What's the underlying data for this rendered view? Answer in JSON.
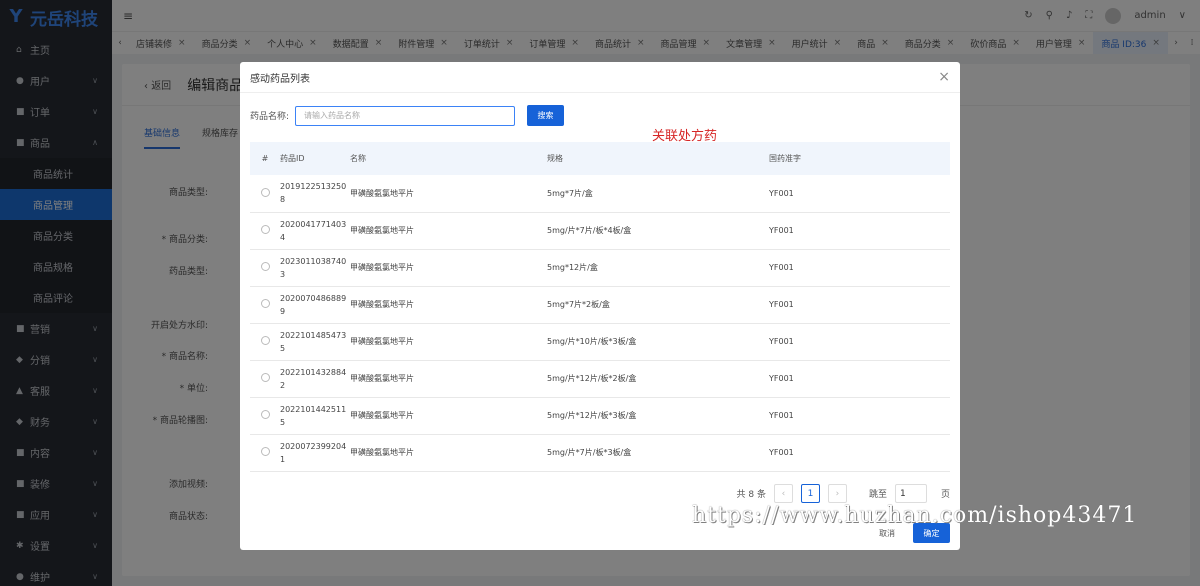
{
  "brand": {
    "name": "元岳科技"
  },
  "sidebar": {
    "items": [
      {
        "label": "主页",
        "icon": "home-icon",
        "glyph": "⌂"
      },
      {
        "label": "用户",
        "icon": "user-icon",
        "glyph": "●",
        "chevron": "∨"
      },
      {
        "label": "订单",
        "icon": "order-icon",
        "glyph": "■",
        "chevron": "∨"
      },
      {
        "label": "商品",
        "icon": "goods-icon",
        "glyph": "■",
        "chevron": "∧"
      }
    ],
    "subitems": [
      {
        "label": "商品统计"
      },
      {
        "label": "商品管理",
        "active": true
      },
      {
        "label": "商品分类"
      },
      {
        "label": "商品规格"
      },
      {
        "label": "商品评论"
      }
    ],
    "items2": [
      {
        "label": "营销",
        "icon": "marketing-icon",
        "glyph": "■",
        "chevron": "∨"
      },
      {
        "label": "分销",
        "icon": "distribution-icon",
        "glyph": "◆",
        "chevron": "∨"
      },
      {
        "label": "客服",
        "icon": "service-icon",
        "glyph": "▲",
        "chevron": "∨"
      },
      {
        "label": "财务",
        "icon": "finance-icon",
        "glyph": "◆",
        "chevron": "∨"
      },
      {
        "label": "内容",
        "icon": "content-icon",
        "glyph": "■",
        "chevron": "∨"
      },
      {
        "label": "装修",
        "icon": "decorate-icon",
        "glyph": "■",
        "chevron": "∨"
      },
      {
        "label": "应用",
        "icon": "apps-icon",
        "glyph": "■",
        "chevron": "∨"
      },
      {
        "label": "设置",
        "icon": "settings-icon",
        "glyph": "✱",
        "chevron": "∨"
      },
      {
        "label": "维护",
        "icon": "maintain-icon",
        "glyph": "●",
        "chevron": "∨"
      }
    ]
  },
  "topbar": {
    "menu_glyph": "≡",
    "user": "admin"
  },
  "tabs": [
    "店铺装修",
    "商品分类",
    "个人中心",
    "数据配置",
    "附件管理",
    "订单统计",
    "订单管理",
    "商品统计",
    "商品管理",
    "文章管理",
    "用户统计",
    "商品",
    "商品分类",
    "砍价商品",
    "用户管理",
    "商品 ID:36"
  ],
  "page": {
    "back": "返回",
    "title": "编辑商品",
    "tab_basic": "基础信息",
    "tab_spec": "规格库存",
    "labels": {
      "type": "商品类型:",
      "category": "* 商品分类:",
      "drug_type": "药品类型:",
      "watermark": "开启处方水印:",
      "name": "* 商品名称:",
      "unit": "* 单位:",
      "images": "* 商品轮播图:",
      "video": "添加视频:",
      "status": "商品状态:"
    }
  },
  "modal": {
    "title": "感动药品列表",
    "search_label": "药品名称:",
    "search_placeholder": "请输入药品名称",
    "search_button": "搜索",
    "annotation": "关联处方药",
    "columns": [
      "#",
      "药品ID",
      "名称",
      "规格",
      "国药准字"
    ],
    "rows": [
      {
        "id": "20191225132508",
        "name": "甲磺酸氨氯地平片",
        "spec": "5mg*7片/盒",
        "code": "YF001"
      },
      {
        "id": "20200417714034",
        "name": "甲磺酸氨氯地平片",
        "spec": "5mg/片*7片/板*4板/盒",
        "code": "YF001"
      },
      {
        "id": "20230110387403",
        "name": "甲磺酸氨氯地平片",
        "spec": "5mg*12片/盒",
        "code": "YF001"
      },
      {
        "id": "20200704868899",
        "name": "甲磺酸氨氯地平片",
        "spec": "5mg*7片*2板/盒",
        "code": "YF001"
      },
      {
        "id": "20221014854735",
        "name": "甲磺酸氨氯地平片",
        "spec": "5mg/片*10片/板*3板/盒",
        "code": "YF001"
      },
      {
        "id": "20221014328842",
        "name": "甲磺酸氨氯地平片",
        "spec": "5mg/片*12片/板*2板/盒",
        "code": "YF001"
      },
      {
        "id": "20221014425115",
        "name": "甲磺酸氨氯地平片",
        "spec": "5mg/片*12片/板*3板/盒",
        "code": "YF001"
      },
      {
        "id": "20200723992041",
        "name": "甲磺酸氨氯地平片",
        "spec": "5mg/片*7片/板*3板/盒",
        "code": "YF001"
      }
    ],
    "pagination": {
      "total": "共 8 条",
      "current": "1",
      "jump_label": "跳至",
      "jump_value": "1",
      "page_suffix": "页"
    },
    "cancel": "取消",
    "confirm": "确定"
  },
  "watermark_text": "https://www.huzhan.com/ishop43471"
}
